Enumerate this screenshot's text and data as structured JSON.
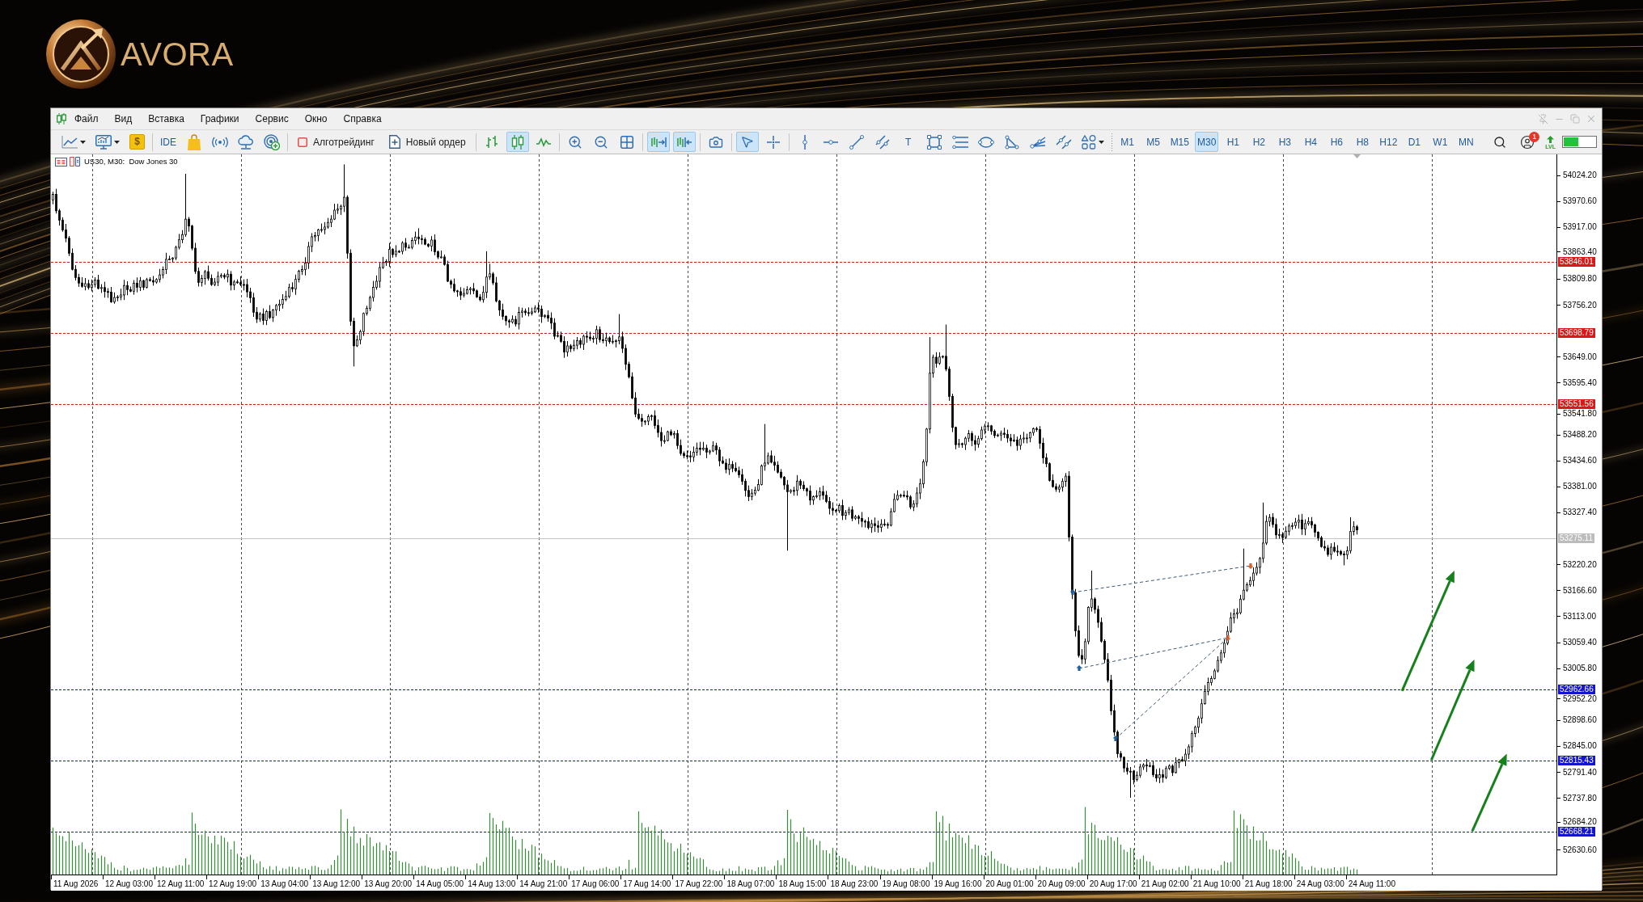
{
  "logo": {
    "text": "AVORA"
  },
  "menu": {
    "items": [
      "Файл",
      "Вид",
      "Вставка",
      "Графики",
      "Сервис",
      "Окно",
      "Справка"
    ],
    "window_controls": {
      "disabled": true
    }
  },
  "toolbar": {
    "dollar_button": "$",
    "ide_button": "IDE",
    "algo_trading": {
      "label": "Алготрейдинг",
      "on": false
    },
    "new_order": "Новый ордер",
    "chart_types": [
      {
        "kind": "bars",
        "selected": false
      },
      {
        "kind": "candles",
        "selected": true
      },
      {
        "kind": "line",
        "selected": false
      }
    ],
    "autoscroll": {
      "selected": true
    },
    "chart_shift": {
      "selected": true
    },
    "pointer_tools": [
      {
        "kind": "cursor",
        "selected": true
      },
      {
        "kind": "crosshair",
        "selected": false
      }
    ],
    "text_tool": "T",
    "timeframes": [
      {
        "label": "M1",
        "selected": false
      },
      {
        "label": "M5",
        "selected": false
      },
      {
        "label": "M15",
        "selected": false
      },
      {
        "label": "M30",
        "selected": true
      },
      {
        "label": "H1",
        "selected": false
      },
      {
        "label": "H2",
        "selected": false
      },
      {
        "label": "H3",
        "selected": false
      },
      {
        "label": "H4",
        "selected": false
      },
      {
        "label": "H6",
        "selected": false
      },
      {
        "label": "H8",
        "selected": false
      },
      {
        "label": "H12",
        "selected": false
      },
      {
        "label": "D1",
        "selected": false
      },
      {
        "label": "W1",
        "selected": false
      },
      {
        "label": "MN",
        "selected": false
      }
    ],
    "notification_badge": "1",
    "level_button": "LVL"
  },
  "chart": {
    "title": "US30, M30:  Dow Jones 30",
    "price_ticks": [
      "54024.20",
      "53970.60",
      "53917.00",
      "53863.40",
      "53809.80",
      "53756.20",
      "53649.00",
      "53595.40",
      "53541.80",
      "53488.20",
      "53434.60",
      "53381.00",
      "53327.40",
      "53220.20",
      "53166.60",
      "53113.00",
      "53059.40",
      "53005.80",
      "52952.20",
      "52898.60",
      "52845.00",
      "52791.40",
      "52737.80",
      "52684.20",
      "52630.60"
    ],
    "levels": [
      {
        "price": "53846.01",
        "color": "#dc1717"
      },
      {
        "price": "53698.79",
        "color": "#dc1717"
      },
      {
        "price": "53551.56",
        "color": "#dc1717"
      },
      {
        "price": "52962.66",
        "color": "#1515cf"
      },
      {
        "price": "52815.43",
        "color": "#1515cf"
      },
      {
        "price": "52668.21",
        "color": "#1515cf"
      }
    ],
    "current_price": "53275.11",
    "time_labels": [
      "11 Aug 2026",
      "12 Aug 03:00",
      "12 Aug 11:00",
      "12 Aug 19:00",
      "13 Aug 04:00",
      "13 Aug 12:00",
      "13 Aug 20:00",
      "14 Aug 05:00",
      "14 Aug 13:00",
      "14 Aug 21:00",
      "17 Aug 06:00",
      "17 Aug 14:00",
      "17 Aug 22:00",
      "18 Aug 07:00",
      "18 Aug 15:00",
      "18 Aug 23:00",
      "19 Aug 08:00",
      "19 Aug 16:00",
      "20 Aug 01:00",
      "20 Aug 09:00",
      "20 Aug 17:00",
      "21 Aug 02:00",
      "21 Aug 10:00",
      "21 Aug 18:00",
      "24 Aug 03:00",
      "24 Aug 11:00"
    ]
  }
}
